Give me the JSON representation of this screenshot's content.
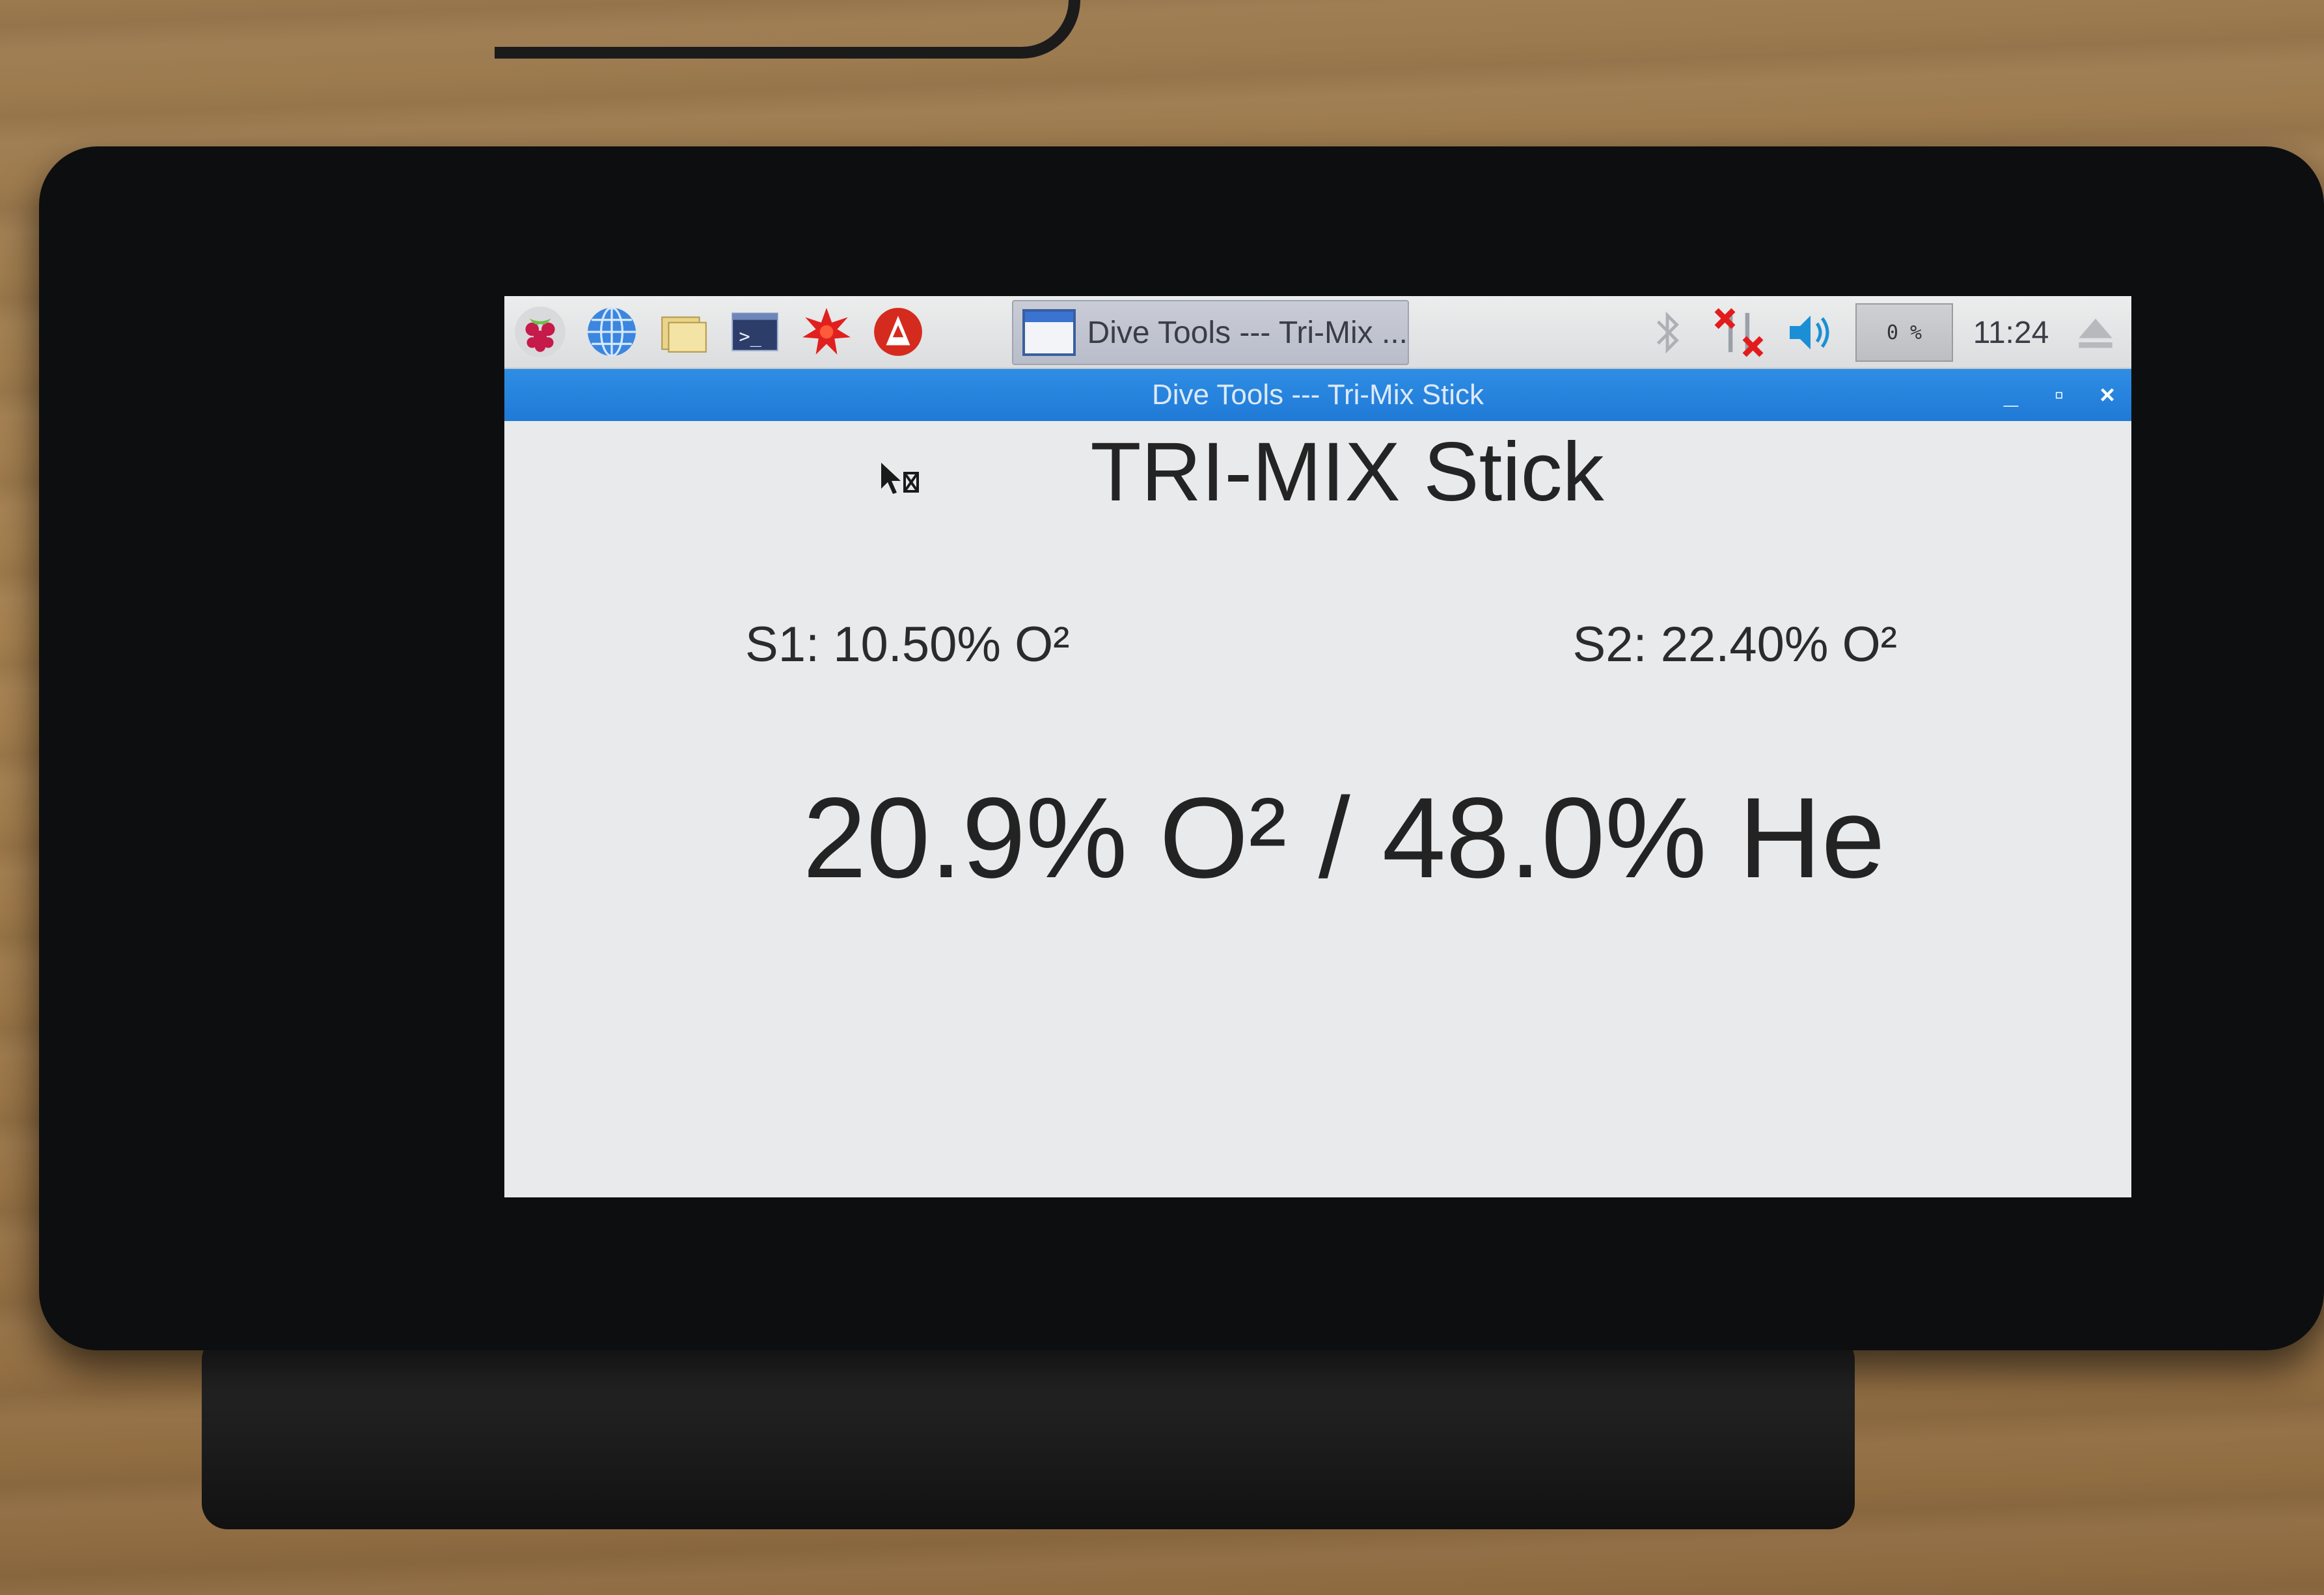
{
  "taskbar": {
    "launchers": [
      {
        "icon": "raspberry-menu-icon"
      },
      {
        "icon": "web-browser-icon"
      },
      {
        "icon": "file-manager-icon"
      },
      {
        "icon": "terminal-icon"
      },
      {
        "icon": "wolfram-icon"
      },
      {
        "icon": "mathematica-icon"
      }
    ],
    "task_label": "Dive Tools --- Tri-Mix ...",
    "cpu": "0 %",
    "clock": "11:24"
  },
  "window": {
    "title": "Dive Tools --- Tri-Mix Stick",
    "controls": {
      "minimize": "_",
      "maximize": "▫",
      "close": "×"
    }
  },
  "app": {
    "heading": "TRI-MIX Stick",
    "sensor1": "S1: 10.50% O²",
    "sensor2": "S2: 22.40% O²",
    "mix": "20.9% O² / 48.0% He"
  },
  "colors": {
    "titlebar": "#1f7ad6",
    "background": "#e9eaec"
  }
}
